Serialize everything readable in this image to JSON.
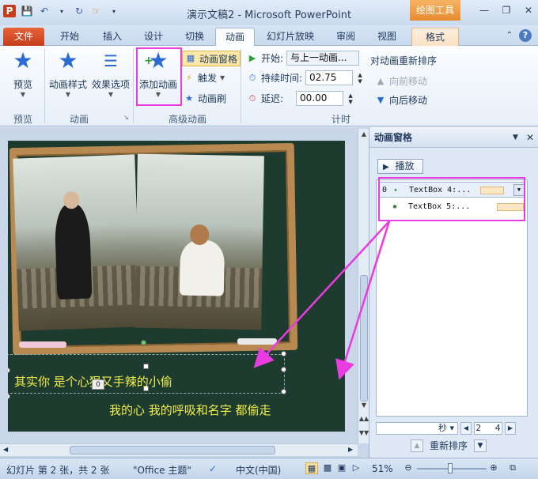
{
  "window": {
    "title": "演示文稿2 - Microsoft PowerPoint",
    "context_group": "绘图工具"
  },
  "tabs": [
    {
      "label": "文件"
    },
    {
      "label": "开始"
    },
    {
      "label": "插入"
    },
    {
      "label": "设计"
    },
    {
      "label": "切换"
    },
    {
      "label": "动画"
    },
    {
      "label": "幻灯片放映"
    },
    {
      "label": "审阅"
    },
    {
      "label": "视图"
    },
    {
      "label": "格式"
    }
  ],
  "ribbon": {
    "preview": {
      "button": "预览",
      "group": "预览"
    },
    "animation": {
      "style_button": "动画样式",
      "effect_button": "效果选项",
      "group": "动画"
    },
    "advanced": {
      "add_button": "添加动画",
      "pane_button": "动画窗格",
      "trigger_button": "触发",
      "painter_button": "动画刷",
      "group": "高级动画"
    },
    "timing": {
      "start_label": "开始:",
      "start_value": "与上一动画...",
      "duration_label": "持续时间:",
      "duration_value": "02.75",
      "delay_label": "延迟:",
      "delay_value": "00.00",
      "group": "计时"
    },
    "reorder": {
      "title": "对动画重新排序",
      "forward": "向前移动",
      "backward": "向后移动"
    }
  },
  "slide": {
    "line1": "其实你 是个心狠又手辣的小偷",
    "line2": "我的心 我的呼吸和名字 都偷走",
    "tag": "0"
  },
  "anim_pane": {
    "title": "动画窗格",
    "play_label": "播放",
    "items": [
      {
        "index": "0",
        "name": "TextBox 4:..."
      },
      {
        "index": "",
        "name": "TextBox 5:..."
      }
    ],
    "timeline_unit": "秒",
    "timeline_page_start": "2",
    "timeline_page_end": "4",
    "reorder_label": "重新排序"
  },
  "status": {
    "slide_info": "幻灯片 第 2 张，共 2 张",
    "theme": "\"Office 主题\"",
    "language": "中文(中国)",
    "zoom": "51%"
  },
  "colors": {
    "accent": "#c43e1c",
    "highlight": "#e83be0",
    "chalk_text": "#f2ef4a",
    "board": "#1d3b2f"
  }
}
